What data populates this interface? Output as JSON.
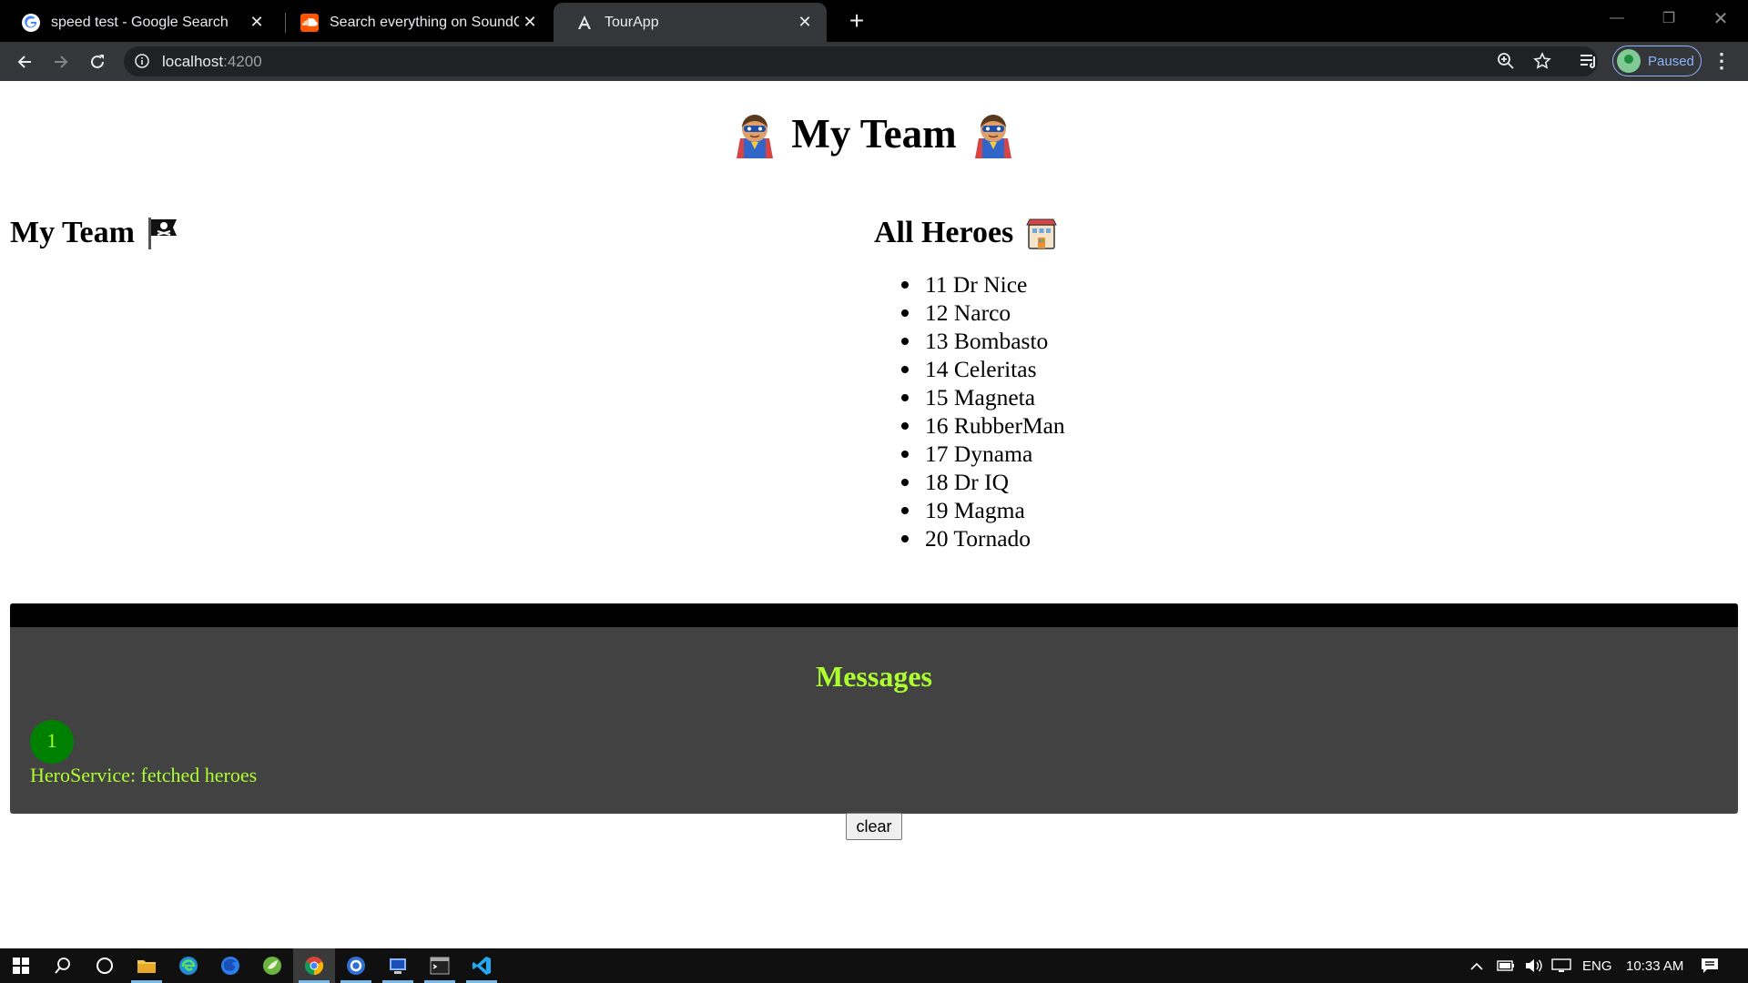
{
  "browser": {
    "tabs": [
      {
        "title": "speed test - Google Search",
        "icon": "google-icon"
      },
      {
        "title": "Search everything on SoundCloud",
        "icon": "soundcloud-icon"
      },
      {
        "title": "TourApp",
        "icon": "angular-icon"
      }
    ],
    "url_host": "localhost",
    "url_port": ":4200",
    "profile_label": "Paused"
  },
  "page": {
    "title": "My Team",
    "team_heading": "My Team",
    "heroes_heading": "All Heroes",
    "heroes": [
      "11 Dr Nice",
      "12 Narco",
      "13 Bombasto",
      "14 Celeritas",
      "15 Magneta",
      "16 RubberMan",
      "17 Dynama",
      "18 Dr IQ",
      "19 Magma",
      "20 Tornado"
    ],
    "messages": {
      "title": "Messages",
      "count": "1",
      "items": [
        "HeroService: fetched heroes"
      ]
    },
    "clear_label": "clear"
  },
  "taskbar": {
    "language": "ENG",
    "time": "10:33 AM"
  },
  "colors": {
    "message_text": "#adff2f",
    "message_panel": "#424242",
    "badge": "#008000"
  }
}
